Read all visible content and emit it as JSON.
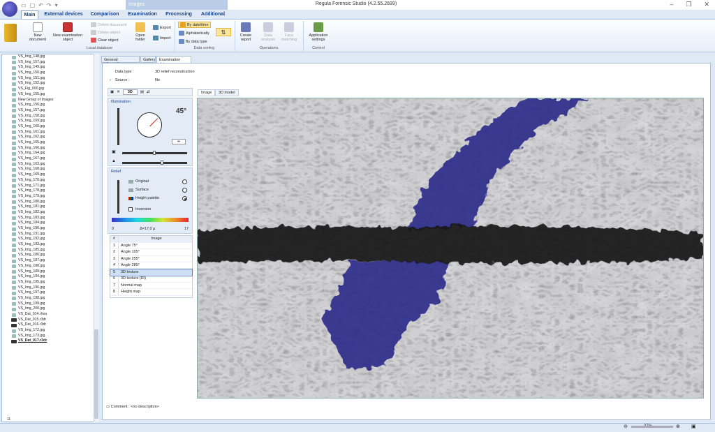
{
  "window": {
    "title": "Regula Forensic Studio (4.2.55.2699)",
    "context_tab": "Images"
  },
  "ribbon_tabs": [
    "Main",
    "External devices",
    "Comparison",
    "Examination",
    "Processing",
    "Additional"
  ],
  "ribbon": {
    "new_document": "New document",
    "new_exam_object": "New examination object",
    "delete_document": "Delete document",
    "delete_object": "Delete object",
    "clear_object": "Clear object",
    "open_folder": "Open folder",
    "export": "Export",
    "import": "Import",
    "by_date": "By date/time",
    "alphabetically": "Alphabetically",
    "by_data_type": "By data type",
    "create_report": "Create report",
    "data_analysis": "Data analysis",
    "face_matching": "Face matching",
    "app_settings": "Application settings",
    "groups": {
      "local_db": "Local database",
      "data_sorting": "Data sorting",
      "operations": "Operations",
      "control": "Control"
    }
  },
  "tree": {
    "items": [
      {
        "label": "VS_Img_148.jpg",
        "t": "img"
      },
      {
        "label": "VS_Img_157.jpg",
        "t": "img"
      },
      {
        "label": "VS_Img_149.jpg",
        "t": "img"
      },
      {
        "label": "VS_Img_150.jpg",
        "t": "img"
      },
      {
        "label": "VS_Img_151.jpg",
        "t": "img"
      },
      {
        "label": "VS_Img_152.jpg",
        "t": "img"
      },
      {
        "label": "VS_Fig_000.jpg",
        "t": "img"
      },
      {
        "label": "VS_Img_155.jpg",
        "t": "img"
      },
      {
        "label": "New Group of Images",
        "t": "grp"
      },
      {
        "label": "VS_Img_156.jpg",
        "t": "img"
      },
      {
        "label": "VS_Img_157.jpg",
        "t": "img"
      },
      {
        "label": "VS_Img_158.jpg",
        "t": "img"
      },
      {
        "label": "VS_Img_159.jpg",
        "t": "img"
      },
      {
        "label": "VS_Img_160.jpg",
        "t": "img"
      },
      {
        "label": "VS_Img_161.jpg",
        "t": "img"
      },
      {
        "label": "VS_Img_162.jpg",
        "t": "img"
      },
      {
        "label": "VS_Img_165.jpg",
        "t": "img"
      },
      {
        "label": "VS_Img_166.jpg",
        "t": "img"
      },
      {
        "label": "VS_Img_164.jpg",
        "t": "img"
      },
      {
        "label": "VS_Img_167.jpg",
        "t": "img"
      },
      {
        "label": "VS_Img_163.jpg",
        "t": "img"
      },
      {
        "label": "VS_Img_168.jpg",
        "t": "img"
      },
      {
        "label": "VS_Img_169.jpg",
        "t": "img"
      },
      {
        "label": "VS_Img_170.jpg",
        "t": "img"
      },
      {
        "label": "VS_Img_171.jpg",
        "t": "img"
      },
      {
        "label": "VS_Img_178.jpg",
        "t": "img"
      },
      {
        "label": "VS_Img_179.jpg",
        "t": "img"
      },
      {
        "label": "VS_Img_180.jpg",
        "t": "img"
      },
      {
        "label": "VS_Img_181.jpg",
        "t": "img"
      },
      {
        "label": "VS_Img_182.jpg",
        "t": "img"
      },
      {
        "label": "VS_Img_183.jpg",
        "t": "img"
      },
      {
        "label": "VS_Img_184.jpg",
        "t": "img"
      },
      {
        "label": "VS_Img_190.jpg",
        "t": "img"
      },
      {
        "label": "VS_Img_191.jpg",
        "t": "img"
      },
      {
        "label": "VS_Img_192.jpg",
        "t": "img"
      },
      {
        "label": "VS_Img_193.jpg",
        "t": "img"
      },
      {
        "label": "VS_Img_185.jpg",
        "t": "img"
      },
      {
        "label": "VS_Img_186.jpg",
        "t": "img"
      },
      {
        "label": "VS_Img_187.jpg",
        "t": "img"
      },
      {
        "label": "VS_Img_188.jpg",
        "t": "img"
      },
      {
        "label": "VS_Img_189.jpg",
        "t": "img"
      },
      {
        "label": "VS_Img_194.jpg",
        "t": "img"
      },
      {
        "label": "VS_Img_195.jpg",
        "t": "img"
      },
      {
        "label": "VS_Img_196.jpg",
        "t": "img"
      },
      {
        "label": "VS_Img_197.jpg",
        "t": "img"
      },
      {
        "label": "VS_Img_198.jpg",
        "t": "img"
      },
      {
        "label": "VS_Img_199.jpg",
        "t": "img"
      },
      {
        "label": "VS_Img_200.jpg",
        "t": "img"
      },
      {
        "label": "VS_Dat_014.rhsa",
        "t": "img"
      },
      {
        "label": "VS_Dat_015.r3dr",
        "t": "3d"
      },
      {
        "label": "VS_Dat_016.r3dr",
        "t": "3d"
      },
      {
        "label": "VS_Img_172.jpg",
        "t": "img"
      },
      {
        "label": "VS_Img_173.jpg",
        "t": "img"
      },
      {
        "label": "VS_Dat_017.r3dr",
        "t": "3d",
        "sel": true
      }
    ],
    "footer": "11"
  },
  "panel_tabs": [
    "General information",
    "Gallery",
    "Examination data"
  ],
  "exam": {
    "data_type_label": "Data type :",
    "data_type_value": "3D relief reconstruction",
    "source_label": "Source :",
    "source_value": "file"
  },
  "tools": {
    "mode": "3D"
  },
  "illumination": {
    "title": "Illumination",
    "angle": "45°"
  },
  "relief": {
    "title": "Relief",
    "options": [
      "Original",
      "Surface",
      "Height palette"
    ],
    "selected": 2,
    "inversion": "Inversion",
    "scale_min": "0",
    "scale_mid": "Δ=17.0 µ",
    "scale_max": "17"
  },
  "image_table": {
    "headers": [
      "#",
      "Image"
    ],
    "rows": [
      [
        "1",
        "Angle 75°"
      ],
      [
        "2",
        "Angle 105°"
      ],
      [
        "3",
        "Angle 255°"
      ],
      [
        "4",
        "Angle 285°"
      ],
      [
        "5",
        "3D texture"
      ],
      [
        "6",
        "3D texture (IR)"
      ],
      [
        "7",
        "Normal map"
      ],
      [
        "8",
        "Height map"
      ]
    ],
    "selected": 4
  },
  "view_tabs": [
    "Image",
    "3D model"
  ],
  "comment": {
    "label": "Comment :",
    "value": "<no description>"
  },
  "status": {
    "zoom": "37%"
  }
}
